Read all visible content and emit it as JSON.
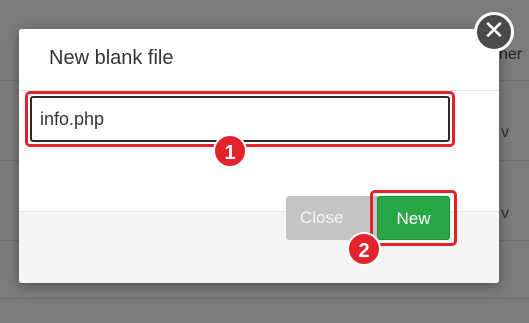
{
  "background": {
    "edge_text": "ner",
    "chevrons": [
      "v",
      "v"
    ]
  },
  "modal": {
    "title": "New blank file",
    "filename_value": "info.php",
    "close_label": "Close",
    "new_label": "New"
  },
  "annotations": {
    "step1": "1",
    "step2": "2"
  },
  "icons": {
    "dismiss": "close-icon",
    "dismiss_glyph": "✕"
  },
  "colors": {
    "highlight": "#e2232b",
    "primary": "#28a745",
    "disabled": "#c4c4c4"
  }
}
